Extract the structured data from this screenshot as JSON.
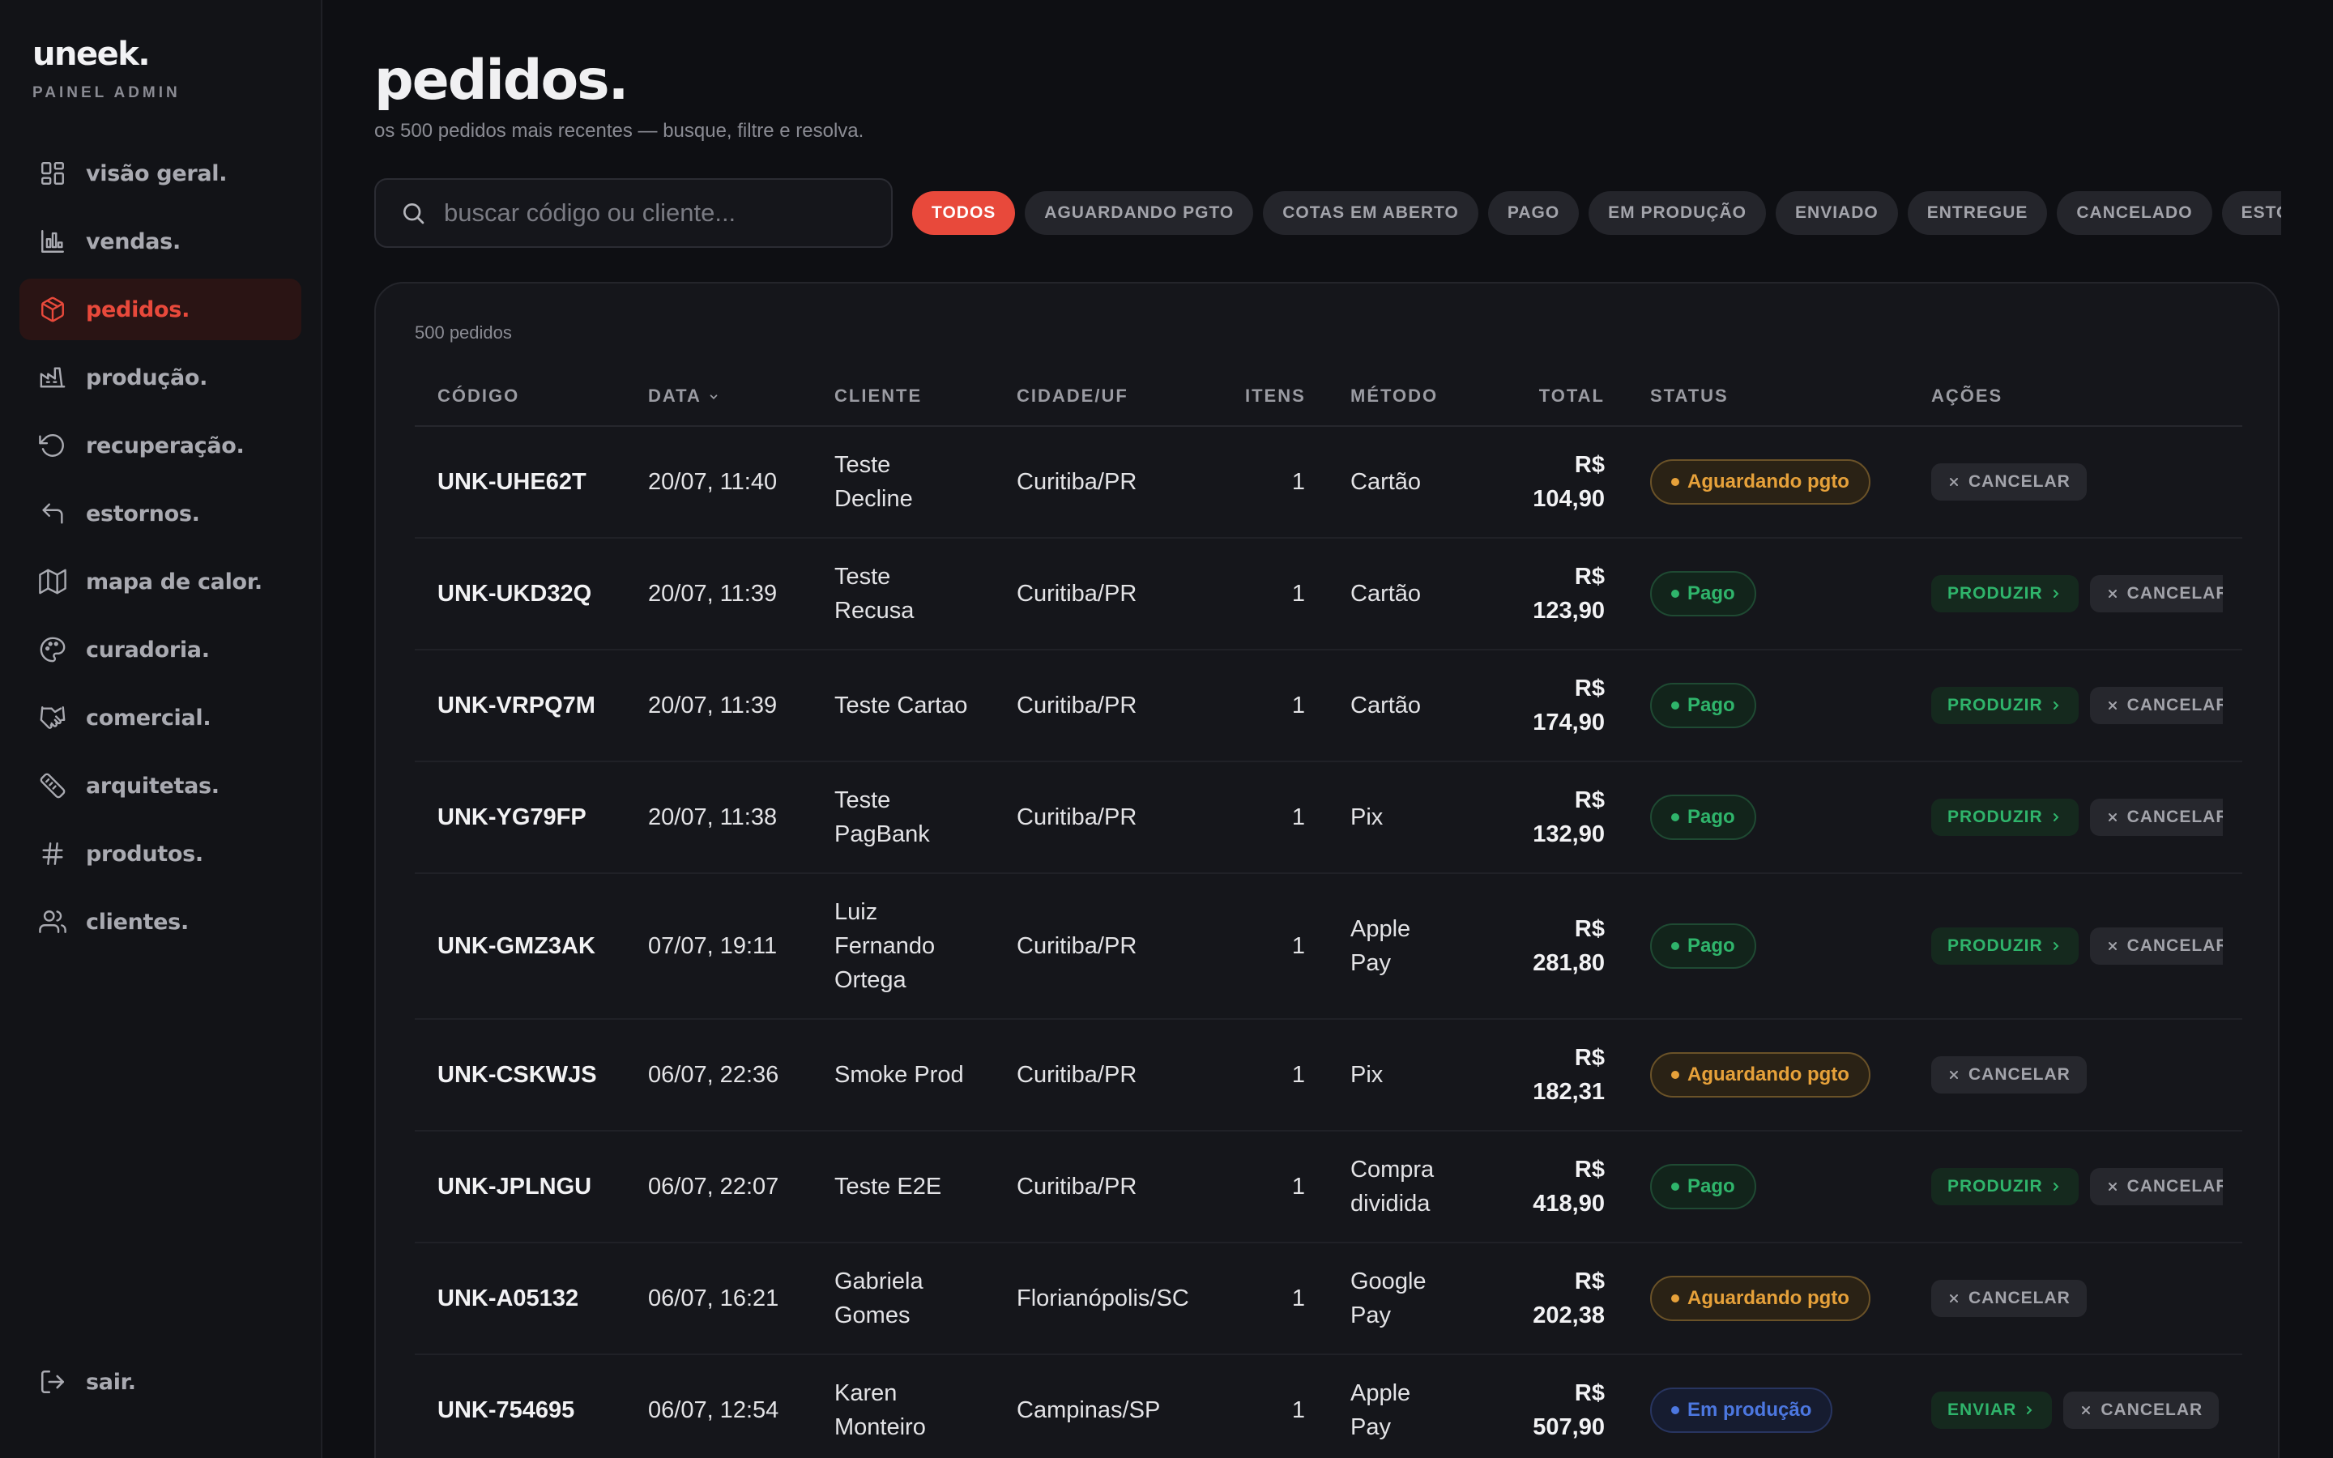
{
  "brand": {
    "name": "uneek.",
    "subtitle": "PAINEL ADMIN"
  },
  "nav": [
    {
      "label": "visão geral.",
      "icon": "dashboard-icon"
    },
    {
      "label": "vendas.",
      "icon": "bar-chart-icon"
    },
    {
      "label": "pedidos.",
      "icon": "box-icon",
      "active": true
    },
    {
      "label": "produção.",
      "icon": "factory-icon"
    },
    {
      "label": "recuperação.",
      "icon": "rotate-ccw-icon"
    },
    {
      "label": "estornos.",
      "icon": "undo-icon"
    },
    {
      "label": "mapa de calor.",
      "icon": "map-icon"
    },
    {
      "label": "curadoria.",
      "icon": "palette-icon"
    },
    {
      "label": "comercial.",
      "icon": "handshake-icon"
    },
    {
      "label": "arquitetas.",
      "icon": "ruler-icon"
    },
    {
      "label": "produtos.",
      "icon": "hash-icon"
    },
    {
      "label": "clientes.",
      "icon": "users-icon"
    }
  ],
  "logout": {
    "label": "sair.",
    "icon": "log-out-icon"
  },
  "page": {
    "title": "pedidos.",
    "subtitle": "os 500 pedidos mais recentes — busque, filtre e resolva."
  },
  "search": {
    "placeholder": "buscar código ou cliente...",
    "value": ""
  },
  "filters": [
    "TODOS",
    "AGUARDANDO PGTO",
    "COTAS EM ABERTO",
    "PAGO",
    "EM PRODUÇÃO",
    "ENVIADO",
    "ENTREGUE",
    "CANCELADO",
    "ESTORNADO"
  ],
  "active_filter": "TODOS",
  "table": {
    "count": "500 pedidos",
    "columns": [
      "CÓDIGO",
      "DATA",
      "CLIENTE",
      "CIDADE/UF",
      "ITENS",
      "MÉTODO",
      "TOTAL",
      "STATUS",
      "AÇÕES"
    ],
    "rows": [
      {
        "code": "UNK-UHE62T",
        "date": "20/07, 11:40",
        "client": "Teste Decline",
        "city": "Curitiba/PR",
        "items": "1",
        "method": "Cartão",
        "total": "R$ 104,90",
        "status": "Aguardando pgto",
        "status_kind": "wait",
        "actions": [
          "CANCELAR"
        ]
      },
      {
        "code": "UNK-UKD32Q",
        "date": "20/07, 11:39",
        "client": "Teste Recusa",
        "city": "Curitiba/PR",
        "items": "1",
        "method": "Cartão",
        "total": "R$ 123,90",
        "status": "Pago",
        "status_kind": "paid",
        "actions": [
          "PRODUZIR",
          "CANCELAR"
        ]
      },
      {
        "code": "UNK-VRPQ7M",
        "date": "20/07, 11:39",
        "client": "Teste Cartao",
        "city": "Curitiba/PR",
        "items": "1",
        "method": "Cartão",
        "total": "R$ 174,90",
        "status": "Pago",
        "status_kind": "paid",
        "actions": [
          "PRODUZIR",
          "CANCELAR"
        ]
      },
      {
        "code": "UNK-YG79FP",
        "date": "20/07, 11:38",
        "client": "Teste PagBank",
        "city": "Curitiba/PR",
        "items": "1",
        "method": "Pix",
        "total": "R$ 132,90",
        "status": "Pago",
        "status_kind": "paid",
        "actions": [
          "PRODUZIR",
          "CANCELAR"
        ]
      },
      {
        "code": "UNK-GMZ3AK",
        "date": "07/07, 19:11",
        "client": "Luiz Fernando Ortega",
        "city": "Curitiba/PR",
        "items": "1",
        "method": "Apple Pay",
        "total": "R$ 281,80",
        "status": "Pago",
        "status_kind": "paid",
        "actions": [
          "PRODUZIR",
          "CANCELAR"
        ]
      },
      {
        "code": "UNK-CSKWJS",
        "date": "06/07, 22:36",
        "client": "Smoke Prod",
        "city": "Curitiba/PR",
        "items": "1",
        "method": "Pix",
        "total": "R$ 182,31",
        "status": "Aguardando pgto",
        "status_kind": "wait",
        "actions": [
          "CANCELAR"
        ]
      },
      {
        "code": "UNK-JPLNGU",
        "date": "06/07, 22:07",
        "client": "Teste E2E",
        "city": "Curitiba/PR",
        "items": "1",
        "method": "Compra dividida",
        "total": "R$ 418,90",
        "status": "Pago",
        "status_kind": "paid",
        "actions": [
          "PRODUZIR",
          "CANCELAR"
        ]
      },
      {
        "code": "UNK-A05132",
        "date": "06/07, 16:21",
        "client": "Gabriela Gomes",
        "city": "Florianópolis/SC",
        "items": "1",
        "method": "Google Pay",
        "total": "R$ 202,38",
        "status": "Aguardando pgto",
        "status_kind": "wait",
        "actions": [
          "CANCELAR"
        ]
      },
      {
        "code": "UNK-754695",
        "date": "06/07, 12:54",
        "client": "Karen Monteiro",
        "city": "Campinas/SP",
        "items": "1",
        "method": "Apple Pay",
        "total": "R$ 507,90",
        "status": "Em produção",
        "status_kind": "prod",
        "actions": [
          "ENVIAR",
          "CANCELAR"
        ]
      }
    ]
  },
  "colors": {
    "accent": "#e8493b",
    "background": "#0e0f13",
    "wait": "#e6a13a",
    "paid": "#2fb46b",
    "production": "#4c77e0"
  }
}
